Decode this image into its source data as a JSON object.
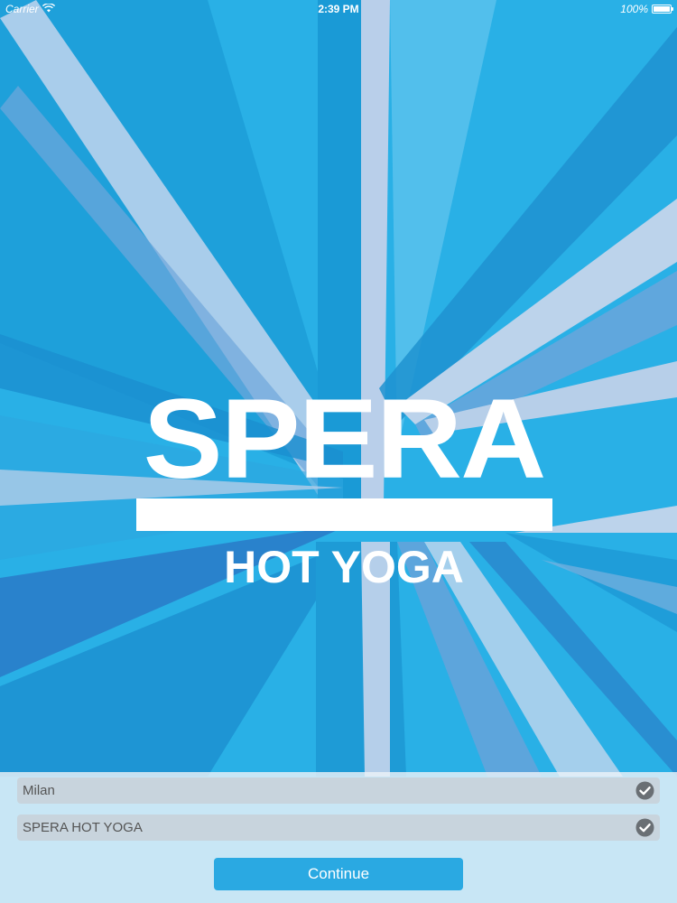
{
  "status_bar": {
    "carrier": "Carrier",
    "time": "2:39 PM",
    "battery": "100%"
  },
  "splash": {
    "brand": "SPERA",
    "tagline": "HOT YOGA"
  },
  "form": {
    "city_value": "Milan",
    "studio_value": "SPERA HOT YOGA",
    "continue_label": "Continue"
  },
  "colors": {
    "background": "#29b0e6",
    "button": "#2aa9e2"
  },
  "icons": [
    "wifi-icon",
    "battery-icon",
    "checkmark-icon"
  ]
}
